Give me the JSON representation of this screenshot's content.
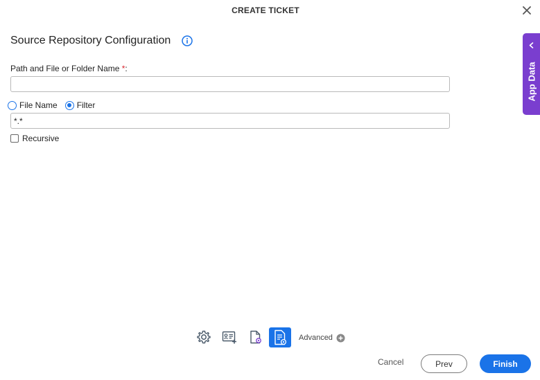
{
  "dialog": {
    "title": "CREATE TICKET"
  },
  "section": {
    "title": "Source Repository Configuration"
  },
  "path_field": {
    "label": "Path and File or Folder Name",
    "required_mark": "*",
    "suffix": ":",
    "value": ""
  },
  "match_mode": {
    "options": [
      {
        "label": "File Name",
        "selected": false
      },
      {
        "label": "Filter",
        "selected": true
      }
    ]
  },
  "filter_field": {
    "value": "*.*"
  },
  "recursive": {
    "label": "Recursive",
    "checked": false
  },
  "side_panel": {
    "label": "App Data"
  },
  "toolbar": {
    "icons": [
      "gear-icon",
      "id-card-add-icon",
      "document-settings-icon",
      "document-list-settings-icon"
    ],
    "active_index": 3,
    "advanced_label": "Advanced"
  },
  "footer": {
    "cancel_label": "Cancel",
    "prev_label": "Prev",
    "finish_label": "Finish"
  },
  "colors": {
    "accent": "#1a73e8",
    "side_tab": "#7a3ecf",
    "required": "#d9262f"
  }
}
